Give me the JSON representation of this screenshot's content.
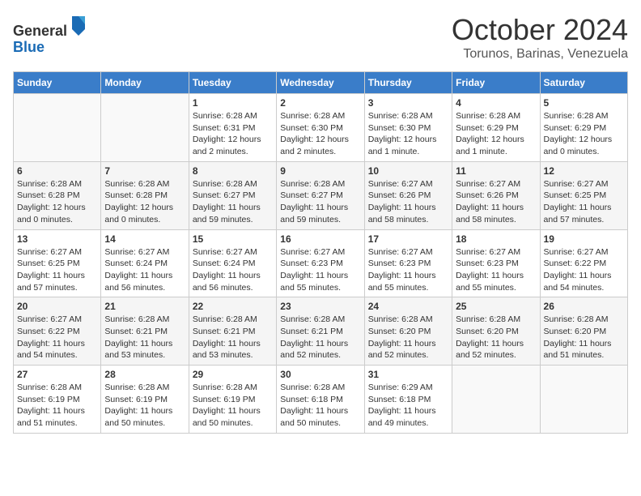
{
  "header": {
    "logo_line1": "General",
    "logo_line2": "Blue",
    "month_title": "October 2024",
    "subtitle": "Torunos, Barinas, Venezuela"
  },
  "calendar": {
    "days_of_week": [
      "Sunday",
      "Monday",
      "Tuesday",
      "Wednesday",
      "Thursday",
      "Friday",
      "Saturday"
    ],
    "weeks": [
      [
        {
          "day": "",
          "sunrise": "",
          "sunset": "",
          "daylight": ""
        },
        {
          "day": "",
          "sunrise": "",
          "sunset": "",
          "daylight": ""
        },
        {
          "day": "1",
          "sunrise": "Sunrise: 6:28 AM",
          "sunset": "Sunset: 6:31 PM",
          "daylight": "Daylight: 12 hours and 2 minutes."
        },
        {
          "day": "2",
          "sunrise": "Sunrise: 6:28 AM",
          "sunset": "Sunset: 6:30 PM",
          "daylight": "Daylight: 12 hours and 2 minutes."
        },
        {
          "day": "3",
          "sunrise": "Sunrise: 6:28 AM",
          "sunset": "Sunset: 6:30 PM",
          "daylight": "Daylight: 12 hours and 1 minute."
        },
        {
          "day": "4",
          "sunrise": "Sunrise: 6:28 AM",
          "sunset": "Sunset: 6:29 PM",
          "daylight": "Daylight: 12 hours and 1 minute."
        },
        {
          "day": "5",
          "sunrise": "Sunrise: 6:28 AM",
          "sunset": "Sunset: 6:29 PM",
          "daylight": "Daylight: 12 hours and 0 minutes."
        }
      ],
      [
        {
          "day": "6",
          "sunrise": "Sunrise: 6:28 AM",
          "sunset": "Sunset: 6:28 PM",
          "daylight": "Daylight: 12 hours and 0 minutes."
        },
        {
          "day": "7",
          "sunrise": "Sunrise: 6:28 AM",
          "sunset": "Sunset: 6:28 PM",
          "daylight": "Daylight: 12 hours and 0 minutes."
        },
        {
          "day": "8",
          "sunrise": "Sunrise: 6:28 AM",
          "sunset": "Sunset: 6:27 PM",
          "daylight": "Daylight: 11 hours and 59 minutes."
        },
        {
          "day": "9",
          "sunrise": "Sunrise: 6:28 AM",
          "sunset": "Sunset: 6:27 PM",
          "daylight": "Daylight: 11 hours and 59 minutes."
        },
        {
          "day": "10",
          "sunrise": "Sunrise: 6:27 AM",
          "sunset": "Sunset: 6:26 PM",
          "daylight": "Daylight: 11 hours and 58 minutes."
        },
        {
          "day": "11",
          "sunrise": "Sunrise: 6:27 AM",
          "sunset": "Sunset: 6:26 PM",
          "daylight": "Daylight: 11 hours and 58 minutes."
        },
        {
          "day": "12",
          "sunrise": "Sunrise: 6:27 AM",
          "sunset": "Sunset: 6:25 PM",
          "daylight": "Daylight: 11 hours and 57 minutes."
        }
      ],
      [
        {
          "day": "13",
          "sunrise": "Sunrise: 6:27 AM",
          "sunset": "Sunset: 6:25 PM",
          "daylight": "Daylight: 11 hours and 57 minutes."
        },
        {
          "day": "14",
          "sunrise": "Sunrise: 6:27 AM",
          "sunset": "Sunset: 6:24 PM",
          "daylight": "Daylight: 11 hours and 56 minutes."
        },
        {
          "day": "15",
          "sunrise": "Sunrise: 6:27 AM",
          "sunset": "Sunset: 6:24 PM",
          "daylight": "Daylight: 11 hours and 56 minutes."
        },
        {
          "day": "16",
          "sunrise": "Sunrise: 6:27 AM",
          "sunset": "Sunset: 6:23 PM",
          "daylight": "Daylight: 11 hours and 55 minutes."
        },
        {
          "day": "17",
          "sunrise": "Sunrise: 6:27 AM",
          "sunset": "Sunset: 6:23 PM",
          "daylight": "Daylight: 11 hours and 55 minutes."
        },
        {
          "day": "18",
          "sunrise": "Sunrise: 6:27 AM",
          "sunset": "Sunset: 6:23 PM",
          "daylight": "Daylight: 11 hours and 55 minutes."
        },
        {
          "day": "19",
          "sunrise": "Sunrise: 6:27 AM",
          "sunset": "Sunset: 6:22 PM",
          "daylight": "Daylight: 11 hours and 54 minutes."
        }
      ],
      [
        {
          "day": "20",
          "sunrise": "Sunrise: 6:27 AM",
          "sunset": "Sunset: 6:22 PM",
          "daylight": "Daylight: 11 hours and 54 minutes."
        },
        {
          "day": "21",
          "sunrise": "Sunrise: 6:28 AM",
          "sunset": "Sunset: 6:21 PM",
          "daylight": "Daylight: 11 hours and 53 minutes."
        },
        {
          "day": "22",
          "sunrise": "Sunrise: 6:28 AM",
          "sunset": "Sunset: 6:21 PM",
          "daylight": "Daylight: 11 hours and 53 minutes."
        },
        {
          "day": "23",
          "sunrise": "Sunrise: 6:28 AM",
          "sunset": "Sunset: 6:21 PM",
          "daylight": "Daylight: 11 hours and 52 minutes."
        },
        {
          "day": "24",
          "sunrise": "Sunrise: 6:28 AM",
          "sunset": "Sunset: 6:20 PM",
          "daylight": "Daylight: 11 hours and 52 minutes."
        },
        {
          "day": "25",
          "sunrise": "Sunrise: 6:28 AM",
          "sunset": "Sunset: 6:20 PM",
          "daylight": "Daylight: 11 hours and 52 minutes."
        },
        {
          "day": "26",
          "sunrise": "Sunrise: 6:28 AM",
          "sunset": "Sunset: 6:20 PM",
          "daylight": "Daylight: 11 hours and 51 minutes."
        }
      ],
      [
        {
          "day": "27",
          "sunrise": "Sunrise: 6:28 AM",
          "sunset": "Sunset: 6:19 PM",
          "daylight": "Daylight: 11 hours and 51 minutes."
        },
        {
          "day": "28",
          "sunrise": "Sunrise: 6:28 AM",
          "sunset": "Sunset: 6:19 PM",
          "daylight": "Daylight: 11 hours and 50 minutes."
        },
        {
          "day": "29",
          "sunrise": "Sunrise: 6:28 AM",
          "sunset": "Sunset: 6:19 PM",
          "daylight": "Daylight: 11 hours and 50 minutes."
        },
        {
          "day": "30",
          "sunrise": "Sunrise: 6:28 AM",
          "sunset": "Sunset: 6:18 PM",
          "daylight": "Daylight: 11 hours and 50 minutes."
        },
        {
          "day": "31",
          "sunrise": "Sunrise: 6:29 AM",
          "sunset": "Sunset: 6:18 PM",
          "daylight": "Daylight: 11 hours and 49 minutes."
        },
        {
          "day": "",
          "sunrise": "",
          "sunset": "",
          "daylight": ""
        },
        {
          "day": "",
          "sunrise": "",
          "sunset": "",
          "daylight": ""
        }
      ]
    ]
  }
}
